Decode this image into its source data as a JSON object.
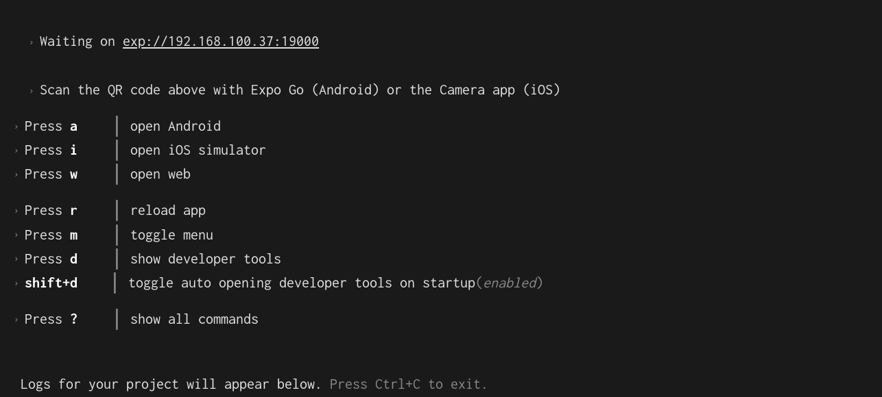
{
  "status": {
    "waiting_prefix": "Waiting on ",
    "url": "exp://192.168.100.37:19000",
    "scan_instruction": "Scan the QR code above with Expo Go (Android) or the Camera app (iOS)"
  },
  "bullet": "›",
  "pipe": "│",
  "groups": [
    {
      "items": [
        {
          "key_prefix": "Press ",
          "key": "a",
          "desc": "open Android"
        },
        {
          "key_prefix": "Press ",
          "key": "i",
          "desc": "open iOS simulator"
        },
        {
          "key_prefix": "Press ",
          "key": "w",
          "desc": "open web"
        }
      ]
    },
    {
      "items": [
        {
          "key_prefix": "Press ",
          "key": "r",
          "desc": "reload app"
        },
        {
          "key_prefix": "Press ",
          "key": "m",
          "desc": "toggle menu"
        },
        {
          "key_prefix": "Press ",
          "key": "d",
          "desc": "show developer tools"
        },
        {
          "key_prefix": "",
          "key": "shift+d",
          "desc": "toggle auto opening developer tools on startup ",
          "status": "(",
          "status_word": "enabled",
          "status_end": ")"
        }
      ]
    },
    {
      "items": [
        {
          "key_prefix": "Press ",
          "key": "?",
          "desc": "show all commands"
        }
      ]
    }
  ],
  "footer": {
    "main": "Logs for your project will appear below. ",
    "hint": "Press Ctrl+C to exit."
  }
}
